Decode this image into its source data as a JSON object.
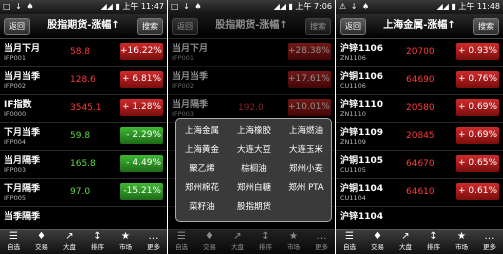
{
  "screens": [
    {
      "status": {
        "left": "□ ↓ ♠",
        "right": "◢◢ ▮ 上午 11:47"
      },
      "back": "返回",
      "title": "股指期货-涨幅↑",
      "search": "搜索",
      "rows": [
        {
          "name": "当月下月",
          "code": "IFP001",
          "price": "58.8",
          "change": "+16.22%",
          "dir": "up"
        },
        {
          "name": "当月当季",
          "code": "IFP002",
          "price": "128.6",
          "change": "+ 6.81%",
          "dir": "up"
        },
        {
          "name": "IF指数",
          "code": "IF0000",
          "price": "3545.1",
          "change": "+ 1.28%",
          "dir": "up"
        },
        {
          "name": "下月当季",
          "code": "IFP004",
          "price": "59.8",
          "change": "- 2.29%",
          "dir": "down"
        },
        {
          "name": "当月隔季",
          "code": "IFP003",
          "price": "165.8",
          "change": "- 4.49%",
          "dir": "down"
        },
        {
          "name": "下月隔季",
          "code": "IFP005",
          "price": "97.0",
          "change": "-15.21%",
          "dir": "down"
        },
        {
          "name": "当季隔季",
          "code": "",
          "price": "",
          "change": "",
          "dir": "none"
        }
      ]
    },
    {
      "status": {
        "left": "□ ↓ ♠",
        "right": "◢◢ ▮ 上午 7:06"
      },
      "back": "返回",
      "title": "股指期货-涨幅↑",
      "search": "搜索",
      "rows": [
        {
          "name": "当月下月",
          "code": "IFP001",
          "price": "",
          "change": "+28.38%",
          "dir": "up"
        },
        {
          "name": "当月当季",
          "code": "IFP002",
          "price": "",
          "change": "+17.61%",
          "dir": "up"
        },
        {
          "name": "当月隔季",
          "code": "IFP003",
          "price": "192.0",
          "change": "+10.01%",
          "dir": "up"
        },
        {
          "name": "",
          "code": "",
          "price": "",
          "change": "",
          "dir": "none"
        },
        {
          "name": "",
          "code": "",
          "price": "",
          "change": "",
          "dir": "none"
        },
        {
          "name": "",
          "code": "",
          "price": "",
          "change": "",
          "dir": "none"
        },
        {
          "name": "",
          "code": "",
          "price": "",
          "change": "",
          "dir": "none"
        }
      ],
      "popup": [
        "上海金属",
        "上海橡胶",
        "上海燃油",
        "上海黄金",
        "大连大豆",
        "大连玉米",
        "聚乙烯",
        "棕榈油",
        "郑州小麦",
        "郑州棉花",
        "郑州白糖",
        "郑州 PTA",
        "菜籽油",
        "股指期货"
      ]
    },
    {
      "status": {
        "left": "⚠ ↓ ♠",
        "right": "◢◢ ▮ 上午 11:48"
      },
      "back": "返回",
      "title": "上海金属-涨幅↑",
      "search": "搜索",
      "rows": [
        {
          "name": "沪锌1106",
          "code": "ZN1106",
          "price": "20700",
          "change": "+ 0.93%",
          "dir": "up"
        },
        {
          "name": "沪铜1106",
          "code": "CU1106",
          "price": "64690",
          "change": "+ 0.76%",
          "dir": "up"
        },
        {
          "name": "沪锌1110",
          "code": "ZN1110",
          "price": "20580",
          "change": "+ 0.69%",
          "dir": "up"
        },
        {
          "name": "沪锌1109",
          "code": "ZN1109",
          "price": "20845",
          "change": "+ 0.69%",
          "dir": "up"
        },
        {
          "name": "沪铜1105",
          "code": "CU1105",
          "price": "64670",
          "change": "+ 0.65%",
          "dir": "up"
        },
        {
          "name": "沪铜1104",
          "code": "CU1104",
          "price": "64610",
          "change": "+ 0.61%",
          "dir": "up"
        },
        {
          "name": "沪锌1104",
          "code": "",
          "price": "",
          "change": "",
          "dir": "none"
        }
      ]
    }
  ],
  "tabs": [
    {
      "icon": "☰",
      "label": "自选"
    },
    {
      "icon": "♦",
      "label": "交易"
    },
    {
      "icon": "↗",
      "label": "大盘"
    },
    {
      "icon": "↕",
      "label": "排序"
    },
    {
      "icon": "★",
      "label": "市场"
    },
    {
      "icon": "…",
      "label": "更多"
    }
  ],
  "colors": {
    "up": "#ff3b3b",
    "down": "#5edb3e",
    "background": "#000000"
  }
}
